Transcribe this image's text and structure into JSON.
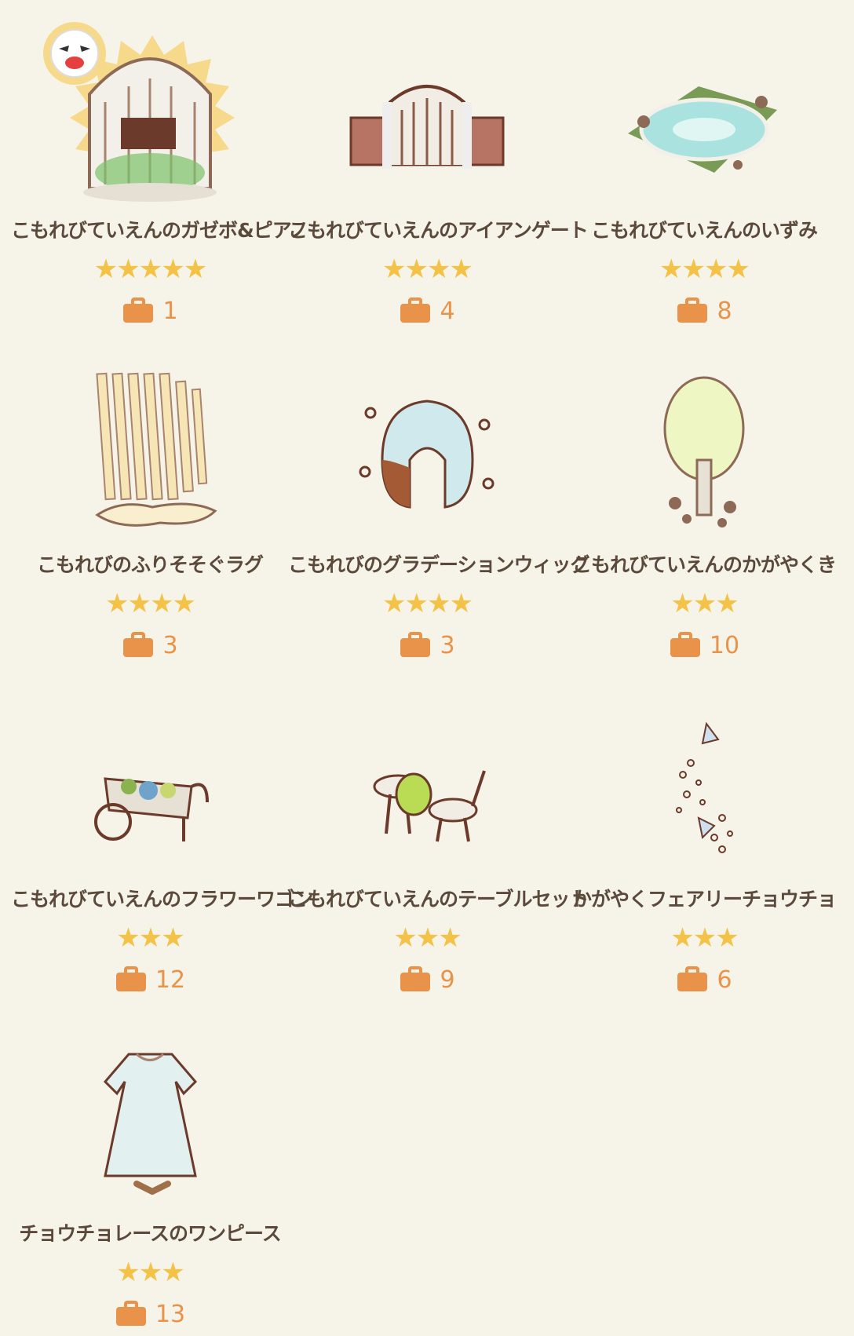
{
  "colors": {
    "background": "#f6f3e8",
    "text": "#5b4a3c",
    "star": "#f3c246",
    "bag": "#e9934a",
    "count": "#e9934a",
    "highlight_badge": "#f7d98b"
  },
  "items": [
    {
      "name": "こもれびていえんのガゼボ&ピアノ",
      "stars": "★★★★★",
      "count": "1",
      "icon": "gazebo-piano-icon"
    },
    {
      "name": "こもれびていえんのアイアンゲート",
      "stars": "★★★★",
      "count": "4",
      "icon": "iron-gate-icon"
    },
    {
      "name": "こもれびていえんのいずみ",
      "stars": "★★★★",
      "count": "8",
      "icon": "fountain-pond-icon"
    },
    {
      "name": "こもれびのふりそそぐラグ",
      "stars": "★★★★",
      "count": "3",
      "icon": "light-rug-icon"
    },
    {
      "name": "こもれびのグラデーションウィッグ",
      "stars": "★★★★",
      "count": "3",
      "icon": "gradient-wig-icon"
    },
    {
      "name": "こもれびていえんのかがやくき",
      "stars": "★★★",
      "count": "10",
      "icon": "shining-tree-icon"
    },
    {
      "name": "こもれびていえんのフラワーワゴン",
      "stars": "★★★",
      "count": "12",
      "icon": "flower-wagon-icon"
    },
    {
      "name": "こもれびていえんのテーブルセット",
      "stars": "★★★",
      "count": "9",
      "icon": "table-set-icon"
    },
    {
      "name": "かがやくフェアリーチョウチョ",
      "stars": "★★★",
      "count": "6",
      "icon": "fairy-butterfly-icon"
    },
    {
      "name": "チョウチョレースのワンピース",
      "stars": "★★★",
      "count": "13",
      "icon": "lace-dress-icon"
    }
  ]
}
